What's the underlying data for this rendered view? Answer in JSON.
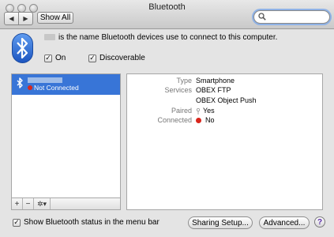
{
  "window": {
    "title": "Bluetooth"
  },
  "toolbar": {
    "show_all_label": "Show All",
    "back_icon": "◀",
    "forward_icon": "▶"
  },
  "search": {
    "value": "",
    "placeholder": ""
  },
  "header": {
    "name_text": "is the name Bluetooth devices use to connect to this computer.",
    "on_label": "On",
    "on_checked": true,
    "discoverable_label": "Discoverable",
    "discoverable_checked": true
  },
  "devices": [
    {
      "status": "Not Connected",
      "selected": true
    }
  ],
  "list_buttons": {
    "add": "+",
    "remove": "−",
    "action": "✲▾"
  },
  "details": {
    "type_label": "Type",
    "type_value": "Smartphone",
    "services_label": "Services",
    "services_values": [
      "OBEX FTP",
      "OBEX Object Push"
    ],
    "paired_label": "Paired",
    "paired_value": "Yes",
    "connected_label": "Connected",
    "connected_value": "No"
  },
  "footer": {
    "show_status_label": "Show Bluetooth status in the menu bar",
    "show_status_checked": true,
    "sharing_setup_label": "Sharing Setup...",
    "advanced_label": "Advanced...",
    "help_label": "?"
  },
  "colors": {
    "selection": "#3875d7",
    "status_red": "#d9261c",
    "bluetooth_blue": "#2f6fd6"
  }
}
